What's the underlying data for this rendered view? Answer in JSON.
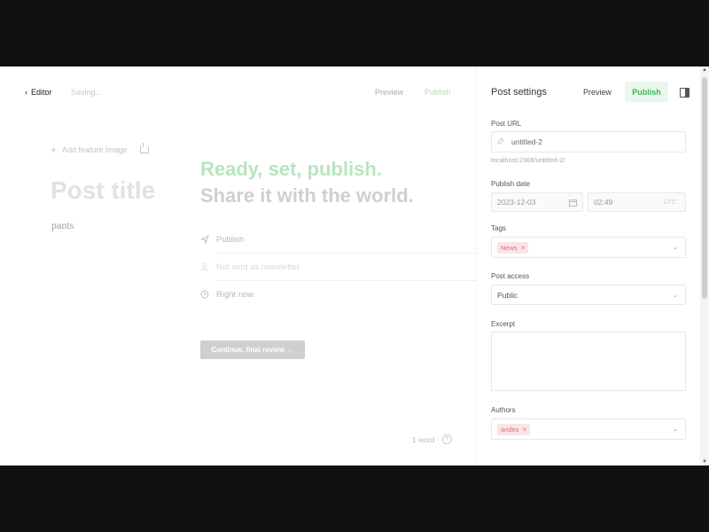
{
  "topbar": {
    "back_label": "Editor",
    "status": "Saving...",
    "preview": "Preview",
    "publish": "Publish"
  },
  "editor": {
    "feature_image": "Add feature image",
    "title_placeholder": "Post title",
    "body_text": "pants",
    "word_count": "1 word",
    "help": "?"
  },
  "publish_flow": {
    "headline": "Ready, set, publish.",
    "subhead": "Share it with the world.",
    "options": [
      {
        "label": "Publish",
        "icon": "send-icon"
      },
      {
        "label": "Not sent as newsletter",
        "icon": "person-icon"
      },
      {
        "label": "Right now",
        "icon": "clock-icon"
      }
    ],
    "continue_button": "Continue, final review →"
  },
  "settings": {
    "title": "Post settings",
    "preview": "Preview",
    "publish": "Publish",
    "post_url_label": "Post URL",
    "post_url_value": "untitled-2",
    "post_url_hint": "localhost:2368/untitled-2/",
    "publish_date_label": "Publish date",
    "date_value": "2023-12-03",
    "time_value": "02:49",
    "tz": "UTC",
    "tags_label": "Tags",
    "tags": [
      "News"
    ],
    "access_label": "Post access",
    "access_value": "Public",
    "excerpt_label": "Excerpt",
    "excerpt_value": "",
    "authors_label": "Authors",
    "authors": [
      "andes"
    ]
  },
  "colors": {
    "publish_green": "#3fb45c",
    "tag_pink": "#e36b82"
  }
}
